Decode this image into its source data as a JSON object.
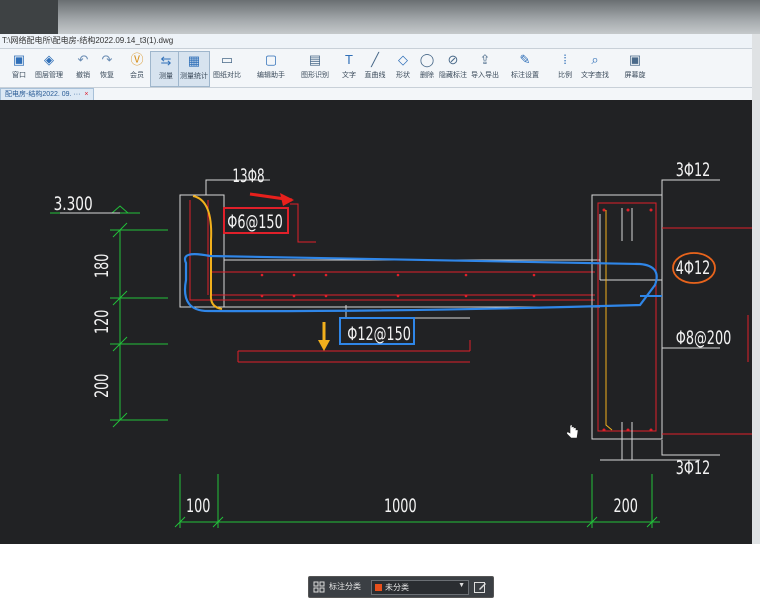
{
  "window": {
    "title": "T:\\网络配电所\\配电房-结构2022.09.14_t3(1).dwg"
  },
  "toolbar": {
    "items": [
      {
        "label": "窗口",
        "icon": "window-icon"
      },
      {
        "label": "图层管理",
        "icon": "layers-icon"
      },
      {
        "label": "撤销",
        "icon": "undo-icon"
      },
      {
        "label": "恢复",
        "icon": "redo-icon"
      },
      {
        "label": "会员",
        "icon": "vip-icon"
      },
      {
        "label": "测量",
        "icon": "measure-icon"
      },
      {
        "label": "测量统计",
        "icon": "measure-stats-icon"
      },
      {
        "label": "图纸对比",
        "icon": "compare-icon"
      },
      {
        "label": "编辑助手",
        "icon": "edit-assistant-icon"
      },
      {
        "label": "图形识别",
        "icon": "recognize-icon"
      },
      {
        "label": "文字",
        "icon": "text-icon"
      },
      {
        "label": "直曲线",
        "icon": "line-icon"
      },
      {
        "label": "形状",
        "icon": "shape-icon"
      },
      {
        "label": "删除",
        "icon": "eraser-icon"
      },
      {
        "label": "隐藏标注",
        "icon": "hide-annotation-icon"
      },
      {
        "label": "导入导出",
        "icon": "import-export-icon"
      },
      {
        "label": "标注设置",
        "icon": "annotation-settings-icon"
      },
      {
        "label": "比例",
        "icon": "scale-icon"
      },
      {
        "label": "文字查找",
        "icon": "text-search-icon"
      },
      {
        "label": "屏幕旋",
        "icon": "rotate-screen-icon"
      }
    ]
  },
  "tabs": {
    "active_label": "配电房-结构2022. 09. ···",
    "close": "×"
  },
  "drawing": {
    "elev": "3.300",
    "top_bar": "13Φ8",
    "stirrup": "Φ6@150",
    "slab_bottom": "Φ12@150",
    "col_top": "3Φ12",
    "col_mid": "4Φ12",
    "col_stirrup": "Φ8@200",
    "col_bot": "3Φ12",
    "dim_180": "180",
    "dim_120": "120",
    "dim_200v": "200",
    "dim_100": "100",
    "dim_1000": "1000",
    "dim_200h": "200"
  },
  "colors": {
    "canvas": "#212224",
    "red_line": "#e0202a",
    "green_dim": "#22c13a",
    "white_text": "#f2f2f2",
    "yellow_mark": "#f2b01c",
    "blue_mark": "#2f86e8",
    "orange_mark": "#e8641c",
    "unclassified": "#e8501c"
  },
  "classify": {
    "label": "标注分类",
    "value": "未分类",
    "arrow": "▼"
  }
}
